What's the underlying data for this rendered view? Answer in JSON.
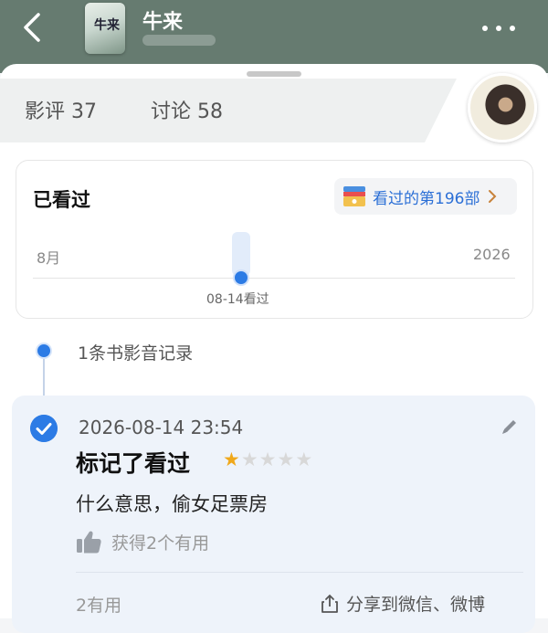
{
  "header": {
    "title": "牛来",
    "poster_text": "牛来",
    "back_icon": "chevron-left-icon",
    "more_icon": "more-dots-icon"
  },
  "tabs": [
    {
      "label": "影评 37"
    },
    {
      "label": "讨论 58"
    }
  ],
  "watched": {
    "title": "已看过",
    "count_label": "看过的第196部",
    "timeline": {
      "start_label": "8月",
      "end_label": "2026",
      "marker_label": "08-14看过"
    }
  },
  "records": {
    "label": "1条书影音记录"
  },
  "review": {
    "timestamp": "2026-08-14 23:54",
    "action": "标记了看过",
    "rating": 1,
    "rating_max": 5,
    "text": "什么意思，偷女足票房",
    "helpful_text": "获得2个有用",
    "useful_count": "2有用",
    "share_text": "分享到微信、微博"
  },
  "colors": {
    "header_bg": "#667b70",
    "accent": "#2c7be5",
    "star": "#f0a81a"
  }
}
